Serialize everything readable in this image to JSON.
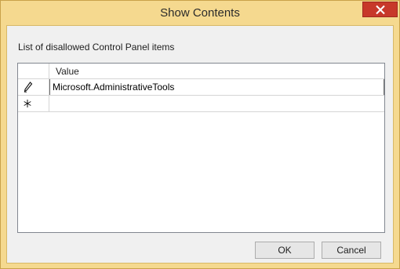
{
  "window": {
    "title": "Show Contents",
    "close_glyph": "✕"
  },
  "caption": "List of disallowed Control Panel items",
  "grid": {
    "column_header": "Value",
    "rows": [
      {
        "indicator": "pencil-icon",
        "value": "Microsoft.AdministrativeTools"
      },
      {
        "indicator": "new-row-icon",
        "value": ""
      }
    ]
  },
  "buttons": {
    "ok": "OK",
    "cancel": "Cancel"
  },
  "colors": {
    "title_bar": "#f5d98f",
    "close_button": "#c7382a",
    "client_bg": "#f0f0f0"
  }
}
